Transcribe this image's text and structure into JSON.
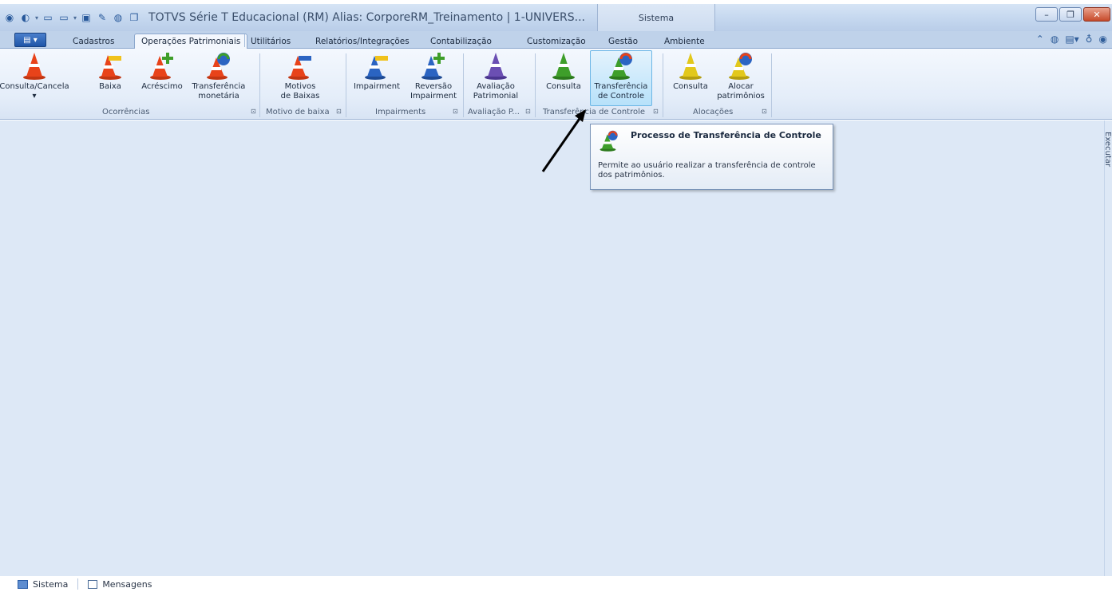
{
  "titlebar": {
    "title": "TOTVS Série T Educacional (RM) Alias: CorporeRM_Treinamento | 1-UNIVERS...",
    "context_tab": "Sistema",
    "window_buttons": {
      "minimize": "–",
      "restore": "❐",
      "close": "✕"
    }
  },
  "tabs": {
    "cadastros": "Cadastros",
    "operacoes": "Operações Patrimoniais",
    "utilitarios": "Utilitários",
    "relatorios": "Relatórios/Integrações",
    "contabilizacao": "Contabilização",
    "customizacao": "Customização",
    "gestao": "Gestão",
    "ambiente": "Ambiente"
  },
  "ribbon": {
    "buttons": {
      "consulta_cancela": "Consulta/Cancela",
      "baixa": "Baixa",
      "acrescimo": "Acréscimo",
      "transf_monetaria_1": "Transferência",
      "transf_monetaria_2": "monetária",
      "motivos_1": "Motivos",
      "motivos_2": "de Baixas",
      "impairment": "Impairment",
      "reversao_1": "Reversão",
      "reversao_2": "Impairment",
      "avaliacao_1": "Avaliação",
      "avaliacao_2": "Patrimonial",
      "consulta_transf": "Consulta",
      "transf_controle_1": "Transferência",
      "transf_controle_2": "de Controle",
      "consulta_aloc": "Consulta",
      "alocar_1": "Alocar",
      "alocar_2": "patrimônios"
    },
    "groups": {
      "ocorrencias": "Ocorrências",
      "motivo_baixa": "Motivo de baixa",
      "impairments": "Impairments",
      "avaliacao": "Avaliação P...",
      "transf_controle": "Transferência de Controle",
      "alocacoes": "Alocações"
    }
  },
  "tooltip": {
    "title": "Processo de Transferência de Controle",
    "description": "Permite ao usuário realizar a transferência de controle dos patrimônios."
  },
  "side_panel": {
    "label": "Executar"
  },
  "statusbar": {
    "sistema": "Sistema",
    "mensagens": "Mensagens"
  },
  "colors": {
    "cone_orange": "#e8431a",
    "cone_green": "#3e9e2a",
    "cone_purple": "#6b4fb3",
    "cone_yellow": "#e2c81c",
    "cone_blue": "#2b64c2"
  }
}
